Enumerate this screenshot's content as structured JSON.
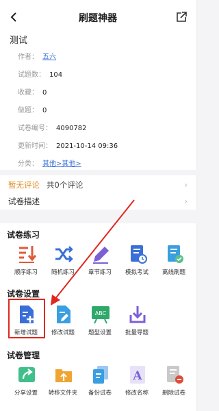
{
  "header": {
    "title": "刷题神器"
  },
  "paper": {
    "title": "测试",
    "author_label": "作者：",
    "author": "五六",
    "count_label": "试题数：",
    "count": "104",
    "fav_label": "收藏：",
    "fav": "0",
    "done_label": "做题：",
    "done": "0",
    "id_label": "试卷编号：",
    "id": "4090782",
    "updated_label": "更新时间：",
    "updated": "2021-10-14 09:36",
    "category_label": "分类：",
    "category": "其他>其他>"
  },
  "comments": {
    "none": "暂无评论",
    "total": "共0个评论",
    "desc": "试卷描述"
  },
  "practice": {
    "title": "试卷练习",
    "items": [
      "顺序练习",
      "随机练习",
      "章节练习",
      "模拟考试",
      "离线刷题"
    ]
  },
  "settings": {
    "title": "试卷设置",
    "items": [
      "新增试题",
      "修改试题",
      "题型设置",
      "批量导题"
    ]
  },
  "manage": {
    "title": "试卷管理",
    "items": [
      "分享设置",
      "转移文件夹",
      "备份试卷",
      "修改名称",
      "删除试卷"
    ]
  },
  "colors": {
    "accent": "#3a6fd8",
    "orange": "#e08a1e",
    "highlight": "#e0281f"
  }
}
